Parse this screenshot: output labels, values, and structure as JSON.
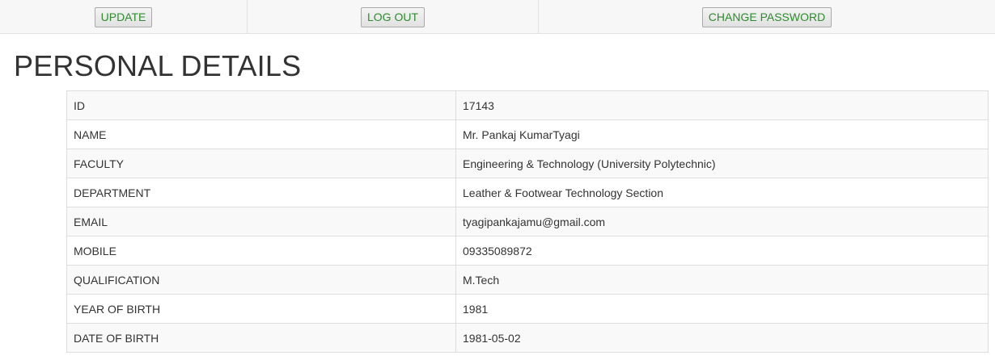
{
  "toolbar": {
    "update_label": "UPDATE",
    "logout_label": "LOG OUT",
    "change_password_label": "CHANGE PASSWORD"
  },
  "page": {
    "title": "PERSONAL DETAILS"
  },
  "details": {
    "rows": [
      {
        "label": "ID",
        "value": "17143"
      },
      {
        "label": "NAME",
        "value": "Mr. Pankaj KumarTyagi"
      },
      {
        "label": "FACULTY",
        "value": "Engineering & Technology (University Polytechnic)"
      },
      {
        "label": "DEPARTMENT",
        "value": "Leather & Footwear Technology Section"
      },
      {
        "label": "EMAIL",
        "value": "tyagipankajamu@gmail.com"
      },
      {
        "label": "MOBILE",
        "value": "09335089872"
      },
      {
        "label": "QUALIFICATION",
        "value": "M.Tech"
      },
      {
        "label": "YEAR OF BIRTH",
        "value": "1981"
      },
      {
        "label": "DATE OF BIRTH",
        "value": "1981-05-02"
      }
    ]
  },
  "colors": {
    "button_text": "#2e8b2e",
    "row_stripe": "#f9f9f9",
    "border": "#dddddd"
  }
}
